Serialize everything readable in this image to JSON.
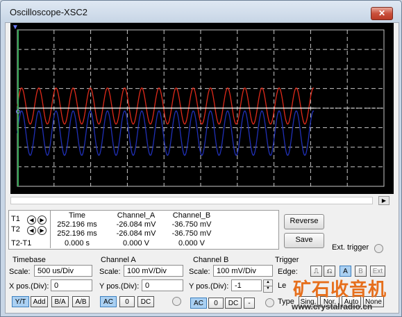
{
  "window": {
    "title": "Oscilloscope-XSC2",
    "close_glyph": "✕"
  },
  "icons": {
    "arrow_left": "◀",
    "arrow_right": "▶",
    "scroll_right": "▶",
    "t1_marker": "▼",
    "spin_up": "▲",
    "spin_down": "▼"
  },
  "colors": {
    "channel_a": "#e02a1a",
    "channel_b": "#2030b8",
    "grid": "#c8c8c8",
    "screen": "#000000",
    "cursor": "#34a853"
  },
  "cursors": {
    "row_labels": [
      "T1",
      "T2",
      "T2-T1"
    ],
    "headers": [
      "Time",
      "Channel_A",
      "Channel_B"
    ],
    "rows": [
      [
        "252.196 ms",
        "-26.084 mV",
        "-36.750 mV"
      ],
      [
        "252.196 ms",
        "-26.084 mV",
        "-36.750 mV"
      ],
      [
        "0.000 s",
        "0.000 V",
        "0.000 V"
      ]
    ]
  },
  "buttons": {
    "reverse": "Reverse",
    "save": "Save"
  },
  "ext_trigger": "Ext. trigger",
  "timebase": {
    "title": "Timebase",
    "scale_label": "Scale:",
    "scale_value": "500 us/Div",
    "xpos_label": "X pos.(Div):",
    "xpos_value": "0",
    "modes": [
      "Y/T",
      "Add",
      "B/A",
      "A/B"
    ],
    "active_mode": "Y/T"
  },
  "channel_a": {
    "title": "Channel A",
    "scale_label": "Scale:",
    "scale_value": "100 mV/Div",
    "ypos_label": "Y pos.(Div):",
    "ypos_value": "0",
    "coupling": [
      "AC",
      "0",
      "DC"
    ],
    "active_coupling": "AC"
  },
  "channel_b": {
    "title": "Channel B",
    "scale_label": "Scale:",
    "scale_value": "100 mV/Div",
    "ypos_label": "Y pos.(Div):",
    "ypos_value": "-1",
    "coupling": [
      "AC",
      "0",
      "DC",
      "-"
    ],
    "active_coupling": "AC"
  },
  "trigger": {
    "title": "Trigger",
    "edge_label": "Edge:",
    "edge_buttons": [
      "⎍",
      "⎌",
      "A",
      "B",
      "Ext"
    ],
    "level_label": "Le",
    "type_label": "Type",
    "type_buttons": [
      "Sing.",
      "Nor.",
      "Auto",
      "None"
    ]
  },
  "watermark": {
    "text": "矿石收音机",
    "url": "www.crystalradio.cn"
  }
}
